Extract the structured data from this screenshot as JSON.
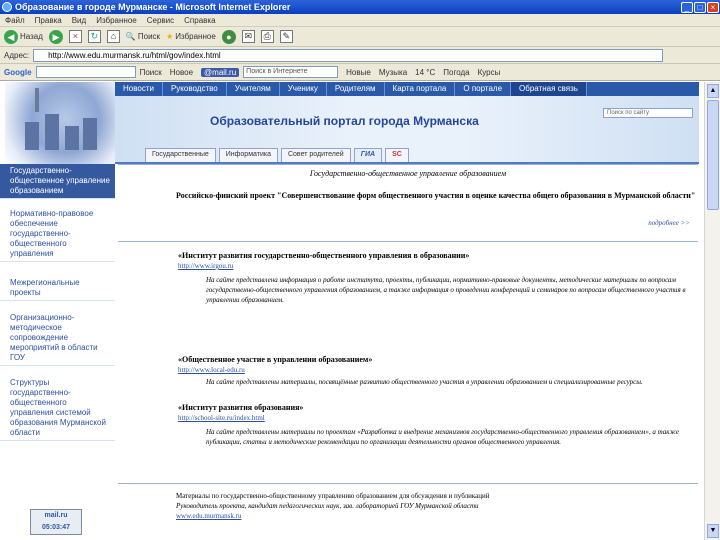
{
  "window": {
    "title": "Образование в городе Мурманске - Microsoft Internet Explorer"
  },
  "menu": [
    "Файл",
    "Правка",
    "Вид",
    "Избранное",
    "Сервис",
    "Справка"
  ],
  "toolbar": {
    "back": "Назад",
    "search": "Поиск",
    "favorites": "Избранное"
  },
  "address": {
    "label": "Адрес:",
    "url": "http://www.edu.murmansk.ru/html/gov/index.html"
  },
  "googlebar": {
    "logo": "Google",
    "items": [
      "Поиск",
      "Новое"
    ],
    "mail_label": "@mail.ru",
    "search_placeholder": "Поиск в Интернете",
    "links": [
      "Новые",
      "Музыка",
      "14 °C",
      "Погода",
      "Курсы"
    ]
  },
  "site": {
    "nav": [
      "Новости",
      "Руководство",
      "Учителям",
      "Ученику",
      "Родителям",
      "Карта портала",
      "О портале",
      "Обратная связь"
    ],
    "active_nav": 7,
    "title": "Образовательный портал города Мурманска",
    "search_placeholder": "Поиск по сайту",
    "subtabs": [
      "Государственные",
      "Информатика",
      "Совет родителей",
      "ГИА",
      "SC"
    ]
  },
  "sidebar": {
    "items": [
      "Государственно-общественное управление образованием",
      "Нормативно-правовое обеспечение государственно-общественного управления",
      "Межрегиональные проекты",
      "Организационно-методическое сопровождение мероприятий в области ГОУ",
      "Структуры государственно-общественного управления системой образования Мурманской области"
    ],
    "counter": "mail.ru 05:03:47"
  },
  "content": {
    "heading": "Государственно-общественное управление образованием",
    "project": "Российско-финский проект \"Совершенствование форм общественного участия в оценке качества общего образования в Мурманской области\"",
    "more": "подробнее >>",
    "sections": [
      {
        "title": "«Институт развития государственно-общественного управления в образовании»",
        "link": "http://www.irgou.ru",
        "text": "На сайте представлена информация о работе института, проекты, публикации, нормативно-правовые документы, методические материалы по вопросам государственно-общественного управления образованием, а также информация о проведении конференций и семинаров по вопросам общественного участия в управлении образованием."
      },
      {
        "title": "«Общественное участие в управлении образованием»",
        "link": "http://www.local-edu.ru",
        "text": "На сайте представлены материалы, посвящённые развитию общественного участия в управлении образованием и специализированные ресурсы."
      },
      {
        "title": "«Институт развития образования»",
        "link": "http://school-site.ru/index.html",
        "text": "На сайте представлены материалы по проектам «Разработка и внедрение механизмов государственно-общественного управления образованием», а также публикации, статьи и методические рекомендации по организации деятельности органов общественного управления."
      }
    ],
    "footer": [
      "Материалы по государственно-общественному управлению образованием для обсуждения и публикаций",
      "Руководитель проекта, кандидат педагогических наук, зав. лабораторией ГОУ Мурманской области",
      "www.edu.murmansk.ru"
    ]
  },
  "colors": {
    "accent": "#2b59a9",
    "link": "#2d50a0",
    "title_bar": "#0a3fc2"
  }
}
